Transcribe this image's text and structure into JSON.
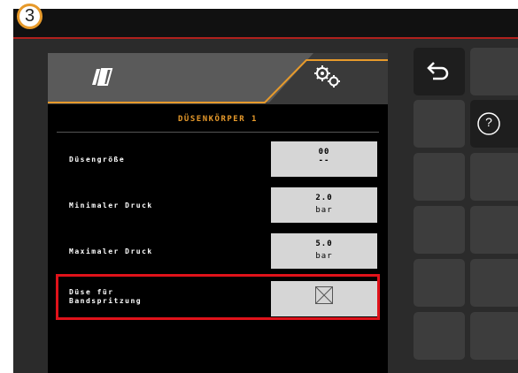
{
  "callout_number": "3",
  "tabs": {
    "left_icon": "sprayer-boom-icon",
    "right_icon": "settings-gears-icon"
  },
  "section_title": "DÜSENKÖRPER 1",
  "params": [
    {
      "label": "Düsengröße",
      "value": "00",
      "unit": "--"
    },
    {
      "label": "Minimaler Druck",
      "value": "2.0",
      "unit": "bar"
    },
    {
      "label": "Maximaler Druck",
      "value": "5.0",
      "unit": "bar"
    }
  ],
  "band_spraying": {
    "label_line1": "Düse für",
    "label_line2": "Bandspritzung",
    "checked": false
  },
  "softkeys": {
    "back_icon": "back-arrow-icon",
    "help_label": "?"
  },
  "colors": {
    "accent_orange": "#e79a2b",
    "highlight_red": "#e0121a",
    "topbar_red_line": "#b0211d"
  }
}
